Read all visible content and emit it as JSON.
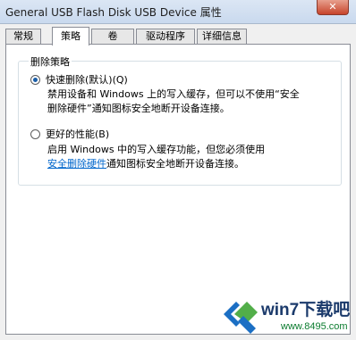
{
  "window": {
    "title": "General USB Flash Disk USB Device 属性",
    "close_label": "✕"
  },
  "tabs": [
    {
      "label": "常规",
      "active": false
    },
    {
      "label": "策略",
      "active": true
    },
    {
      "label": "卷",
      "active": false
    },
    {
      "label": "驱动程序",
      "active": false
    },
    {
      "label": "详细信息",
      "active": false
    }
  ],
  "group": {
    "legend": "删除策略",
    "options": [
      {
        "label": "快速删除(默认)(Q)",
        "checked": true,
        "desc_line1": "禁用设备和 Windows 上的写入缓存，但可以不使用“安全",
        "desc_line2": "删除硬件”通知图标安全地断开设备连接。"
      },
      {
        "label": "更好的性能(B)",
        "checked": false,
        "desc_line1": "启用 Windows 中的写入缓存功能，但您必须使用",
        "desc_link": "安全删除硬件",
        "desc_line2_rest": "通知图标安全地断开设备连接。"
      }
    ]
  },
  "watermark": {
    "name": "win7下载吧",
    "url": "www.8495.com",
    "colors": {
      "blue": "#1b6fc4",
      "green": "#3fa535",
      "text": "#1b3a6b"
    }
  }
}
